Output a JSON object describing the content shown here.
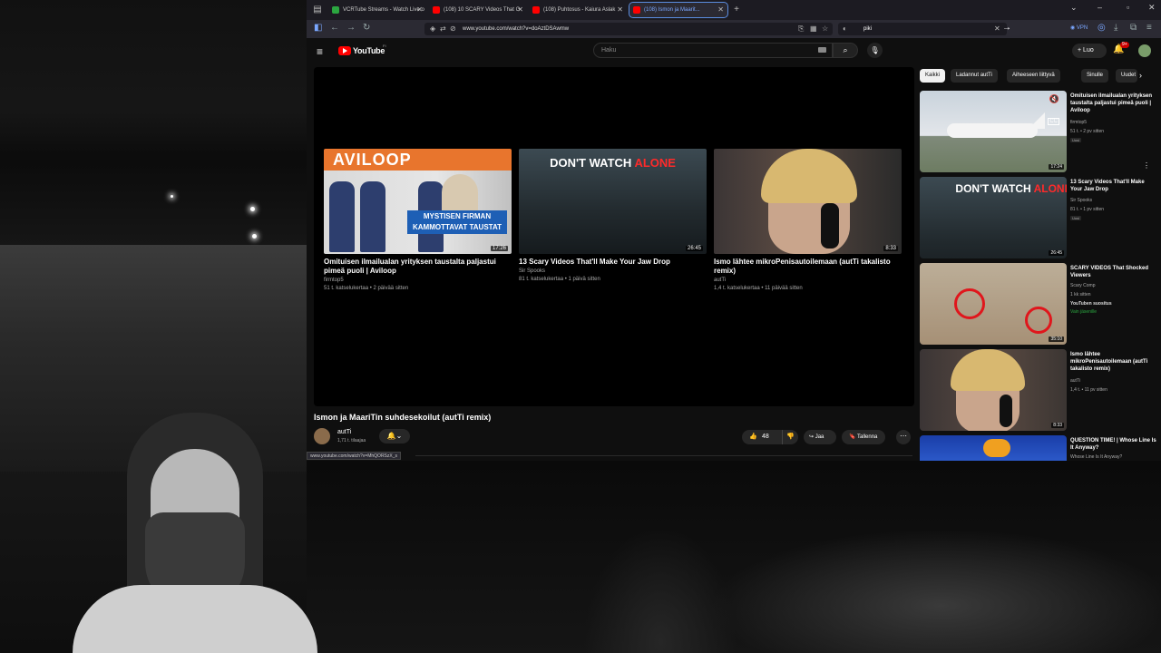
{
  "browser": {
    "tabs": [
      {
        "label": "VCRTube Streams - Watch Live o",
        "favicon_color": "#2ba640"
      },
      {
        "label": "(108) 10 SCARY Videos That G",
        "favicon_color": "#ff0000"
      },
      {
        "label": "(108) Puhtosus - Kaiura Aslak",
        "favicon_color": "#ff0000"
      },
      {
        "label": "(108) Ismon ja Maarit...",
        "favicon_color": "#ff0000"
      }
    ],
    "new_tab": "+",
    "url": "www.youtube.com/watch?v=doAztDSAwmw",
    "search_query": "piki",
    "vpn_label": "VPN",
    "status_url": "www.youtube.com/watch?v=MhQORSzX_s"
  },
  "youtube": {
    "logo_text": "YouTube",
    "logo_sup": "FI",
    "search_placeholder": "Haku",
    "create_label": "Luo",
    "notif_count": "9+"
  },
  "end_screen": [
    {
      "title": "Omituisen ilmailualan yrityksen taustalta paljastui pimeä puoli | Aviloop",
      "channel": "firmtop5",
      "meta": "51 t. katselukertaa • 2 päivää sitten",
      "duration": "17:26",
      "banner": "AVILOOP",
      "box_text": "MYSTISEN FIRMAN KAMMOTTAVAT TAUSTAT"
    },
    {
      "title": "13 Scary Videos That'll Make Your Jaw Drop",
      "channel": "Sir Spooks",
      "meta": "81 t. katselukertaa • 1 päivä sitten",
      "duration": "26:45",
      "banner_white": "DON'T WATCH",
      "banner_red": "ALONE"
    },
    {
      "title": "Ismo lähtee mikroPenisautoilemaan (autTi takalisto remix)",
      "channel": "autTi",
      "meta": "1,4 t. katselukertaa • 11 päivää sitten",
      "duration": "8:33"
    }
  ],
  "video": {
    "title": "Ismon ja MaariTin suhdesekoilut (autTi remix)",
    "channel": "autTi",
    "subscribers": "1,71 t. tilaajaa",
    "likes": "48",
    "share_label": "Jaa",
    "save_label": "Tallenna"
  },
  "chips": [
    "Kaikki",
    "Ladannut autTi",
    "Aiheeseen liittyvä",
    "Sinulle",
    "Uudet"
  ],
  "recommendations": [
    {
      "title": "Omituisen ilmailualan yrityksen taustalta paljastui pimeä puoli | Aviloop",
      "channel": "firmtop5",
      "meta": "51 t. • 2 pv sitten",
      "badge": "Uusi",
      "duration": "17:24"
    },
    {
      "title": "13 Scary Videos That'll Make Your Jaw Drop",
      "channel": "Sir Spooks",
      "meta": "81 t. • 1 pv sitten",
      "badge": "Uusi",
      "duration": "26:45",
      "banner_white": "DON'T WATCH",
      "banner_red": "ALONE"
    },
    {
      "title": "SCARY VIDEOS That Shocked Viewers",
      "channel": "Scary Comp",
      "meta": "1 kk sitten",
      "premium": "YouTuben suositus",
      "member": "Vain jäsenille",
      "duration": "35:10"
    },
    {
      "title": "Ismo lähtee mikroPenisautoilemaan (autTi takalisto remix)",
      "channel": "autTi",
      "meta": "1,4 t. • 11 pv sitten",
      "duration": "8:33"
    },
    {
      "title": "QUESTION TIME! | Whose Line Is It Anyway?",
      "channel": "Whose Line Is It Anyway?"
    }
  ],
  "colors": {
    "yt_red": "#ff0000",
    "accent_blue": "#7aa7ff",
    "member_green": "#2ba640"
  }
}
